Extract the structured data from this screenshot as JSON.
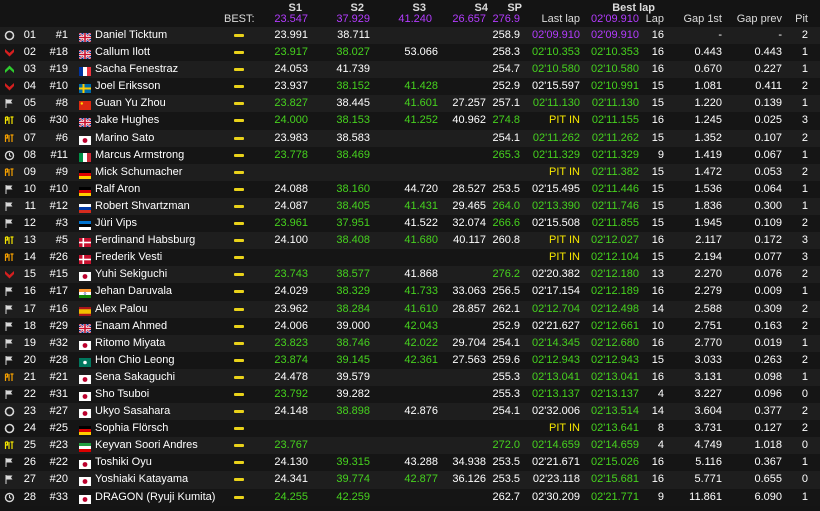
{
  "header": {
    "best_label": "BEST:",
    "columns": {
      "s1": "S1",
      "s2": "S2",
      "s3": "S3",
      "s4": "S4",
      "sp": "SP",
      "last_lap": "Last lap",
      "best_lap": "Best lap",
      "lap": "Lap",
      "gap_1st": "Gap 1st",
      "gap_prev": "Gap prev",
      "pit": "Pit"
    },
    "best": {
      "s1": "23.547",
      "s2": "37.929",
      "s3": "41.240",
      "s4": "26.657",
      "sp": "276.9",
      "best_lap": "02'09.910"
    }
  },
  "colors": {
    "white": "#ffffff",
    "green": "#46d21e",
    "purple": "#b43cff",
    "yellow": "#f5e600"
  },
  "rows": [
    {
      "status": "circle-icon",
      "pos": "01",
      "num": "#1",
      "flag": "gb",
      "name": "Daniel Ticktum",
      "s1": "23.991",
      "s1c": "w",
      "s2": "38.711",
      "s2c": "w",
      "s3": "",
      "s3c": "w",
      "s4": "",
      "s4c": "w",
      "sp": "258.9",
      "spc": "w",
      "last": "02'09.910",
      "lastc": "p",
      "best": "02'09.910",
      "bestc": "p",
      "lap": "16",
      "gap1": "-",
      "gapp": "-",
      "pit": "2"
    },
    {
      "status": "chevron-down-icon",
      "pos": "02",
      "num": "#18",
      "flag": "gb",
      "name": "Callum Ilott",
      "s1": "23.917",
      "s1c": "g",
      "s2": "38.027",
      "s2c": "g",
      "s3": "53.066",
      "s3c": "w",
      "s4": "",
      "s4c": "w",
      "sp": "258.3",
      "spc": "w",
      "last": "02'10.353",
      "lastc": "g",
      "best": "02'10.353",
      "bestc": "g",
      "lap": "16",
      "gap1": "0.443",
      "gapp": "0.443",
      "pit": "1"
    },
    {
      "status": "chevron-up-icon",
      "pos": "03",
      "num": "#19",
      "flag": "fr",
      "name": "Sacha Fenestraz",
      "s1": "24.053",
      "s1c": "w",
      "s2": "41.739",
      "s2c": "w",
      "s3": "",
      "s3c": "w",
      "s4": "",
      "s4c": "w",
      "sp": "254.7",
      "spc": "w",
      "last": "02'10.580",
      "lastc": "g",
      "best": "02'10.580",
      "bestc": "g",
      "lap": "16",
      "gap1": "0.670",
      "gapp": "0.227",
      "pit": "1"
    },
    {
      "status": "chevron-down-icon",
      "pos": "04",
      "num": "#10",
      "flag": "se",
      "name": "Joel Eriksson",
      "s1": "23.937",
      "s1c": "w",
      "s2": "38.152",
      "s2c": "g",
      "s3": "41.428",
      "s3c": "g",
      "s4": "",
      "s4c": "w",
      "sp": "252.9",
      "spc": "w",
      "last": "02'15.597",
      "lastc": "w",
      "best": "02'10.991",
      "bestc": "g",
      "lap": "15",
      "gap1": "1.081",
      "gapp": "0.411",
      "pit": "2"
    },
    {
      "status": "flag-icon",
      "pos": "05",
      "num": "#8",
      "flag": "cn",
      "name": "Guan Yu Zhou",
      "s1": "23.827",
      "s1c": "g",
      "s2": "38.445",
      "s2c": "w",
      "s3": "41.601",
      "s3c": "g",
      "s4": "27.257",
      "s4c": "w",
      "sp": "257.1",
      "spc": "w",
      "last": "02'11.130",
      "lastc": "g",
      "best": "02'11.130",
      "bestc": "g",
      "lap": "15",
      "gap1": "1.220",
      "gapp": "0.139",
      "pit": "1"
    },
    {
      "status": "pit-icon",
      "pos": "06",
      "num": "#30",
      "flag": "gb",
      "name": "Jake Hughes",
      "s1": "24.000",
      "s1c": "g",
      "s2": "38.153",
      "s2c": "g",
      "s3": "41.252",
      "s3c": "g",
      "s4": "40.962",
      "s4c": "w",
      "sp": "274.8",
      "spc": "g",
      "last": "PIT IN",
      "lastc": "y",
      "best": "02'11.155",
      "bestc": "g",
      "lap": "16",
      "gap1": "1.245",
      "gapp": "0.025",
      "pit": "3"
    },
    {
      "status": "pit-out-icon",
      "pos": "07",
      "num": "#6",
      "flag": "jp",
      "name": "Marino Sato",
      "s1": "23.983",
      "s1c": "w",
      "s2": "38.583",
      "s2c": "w",
      "s3": "",
      "s3c": "w",
      "s4": "",
      "s4c": "w",
      "sp": "254.1",
      "spc": "w",
      "last": "02'11.262",
      "lastc": "g",
      "best": "02'11.262",
      "bestc": "g",
      "lap": "15",
      "gap1": "1.352",
      "gapp": "0.107",
      "pit": "2"
    },
    {
      "status": "clock-icon",
      "pos": "08",
      "num": "#11",
      "flag": "it",
      "name": "Marcus Armstrong",
      "s1": "23.778",
      "s1c": "g",
      "s2": "38.469",
      "s2c": "g",
      "s3": "",
      "s3c": "w",
      "s4": "",
      "s4c": "w",
      "sp": "265.3",
      "spc": "g",
      "last": "02'11.329",
      "lastc": "g",
      "best": "02'11.329",
      "bestc": "g",
      "lap": "9",
      "gap1": "1.419",
      "gapp": "0.067",
      "pit": "1"
    },
    {
      "status": "pit-out-icon",
      "pos": "09",
      "num": "#9",
      "flag": "de",
      "name": "Mick Schumacher",
      "s1": "",
      "s1c": "w",
      "s2": "",
      "s2c": "w",
      "s3": "",
      "s3c": "w",
      "s4": "",
      "s4c": "w",
      "sp": "",
      "spc": "w",
      "last": "PIT IN",
      "lastc": "y",
      "best": "02'11.382",
      "bestc": "g",
      "lap": "15",
      "gap1": "1.472",
      "gapp": "0.053",
      "pit": "2"
    },
    {
      "status": "flag-icon",
      "pos": "10",
      "num": "#10",
      "flag": "de",
      "name": "Ralf Aron",
      "s1": "24.088",
      "s1c": "w",
      "s2": "38.160",
      "s2c": "g",
      "s3": "44.720",
      "s3c": "w",
      "s4": "28.527",
      "s4c": "w",
      "sp": "253.5",
      "spc": "w",
      "last": "02'15.495",
      "lastc": "w",
      "best": "02'11.446",
      "bestc": "g",
      "lap": "15",
      "gap1": "1.536",
      "gapp": "0.064",
      "pit": "1"
    },
    {
      "status": "flag-icon",
      "pos": "11",
      "num": "#12",
      "flag": "ru",
      "name": "Robert Shvartzman",
      "s1": "24.087",
      "s1c": "w",
      "s2": "38.405",
      "s2c": "g",
      "s3": "41.431",
      "s3c": "g",
      "s4": "29.465",
      "s4c": "w",
      "sp": "264.0",
      "spc": "g",
      "last": "02'13.390",
      "lastc": "g",
      "best": "02'11.746",
      "bestc": "g",
      "lap": "15",
      "gap1": "1.836",
      "gapp": "0.300",
      "pit": "1"
    },
    {
      "status": "flag-icon",
      "pos": "12",
      "num": "#3",
      "flag": "ee",
      "name": "Jüri Vips",
      "s1": "23.961",
      "s1c": "g",
      "s2": "37.951",
      "s2c": "g",
      "s3": "41.522",
      "s3c": "w",
      "s4": "32.074",
      "s4c": "w",
      "sp": "266.6",
      "spc": "g",
      "last": "02'15.508",
      "lastc": "w",
      "best": "02'11.855",
      "bestc": "g",
      "lap": "15",
      "gap1": "1.945",
      "gapp": "0.109",
      "pit": "2"
    },
    {
      "status": "pit-icon",
      "pos": "13",
      "num": "#5",
      "flag": "dk",
      "name": "Ferdinand Habsburg",
      "s1": "24.100",
      "s1c": "w",
      "s2": "38.408",
      "s2c": "g",
      "s3": "41.680",
      "s3c": "g",
      "s4": "40.117",
      "s4c": "w",
      "sp": "260.8",
      "spc": "w",
      "last": "PIT IN",
      "lastc": "y",
      "best": "02'12.027",
      "bestc": "g",
      "lap": "16",
      "gap1": "2.117",
      "gapp": "0.172",
      "pit": "3"
    },
    {
      "status": "pit-out-icon",
      "pos": "14",
      "num": "#26",
      "flag": "dk",
      "name": "Frederik Vesti",
      "s1": "",
      "s1c": "w",
      "s2": "",
      "s2c": "w",
      "s3": "",
      "s3c": "w",
      "s4": "",
      "s4c": "w",
      "sp": "",
      "spc": "w",
      "last": "PIT IN",
      "lastc": "y",
      "best": "02'12.104",
      "bestc": "g",
      "lap": "15",
      "gap1": "2.194",
      "gapp": "0.077",
      "pit": "3"
    },
    {
      "status": "chevron-down-icon",
      "pos": "15",
      "num": "#15",
      "flag": "jp",
      "name": "Yuhi Sekiguchi",
      "s1": "23.743",
      "s1c": "g",
      "s2": "38.577",
      "s2c": "g",
      "s3": "41.868",
      "s3c": "w",
      "s4": "",
      "s4c": "w",
      "sp": "276.2",
      "spc": "g",
      "last": "02'20.382",
      "lastc": "w",
      "best": "02'12.180",
      "bestc": "g",
      "lap": "13",
      "gap1": "2.270",
      "gapp": "0.076",
      "pit": "2"
    },
    {
      "status": "flag-icon",
      "pos": "16",
      "num": "#17",
      "flag": "in",
      "name": "Jehan Daruvala",
      "s1": "24.029",
      "s1c": "w",
      "s2": "38.329",
      "s2c": "g",
      "s3": "41.733",
      "s3c": "g",
      "s4": "33.063",
      "s4c": "w",
      "sp": "256.5",
      "spc": "w",
      "last": "02'17.154",
      "lastc": "w",
      "best": "02'12.189",
      "bestc": "g",
      "lap": "16",
      "gap1": "2.279",
      "gapp": "0.009",
      "pit": "1"
    },
    {
      "status": "flag-icon",
      "pos": "17",
      "num": "#16",
      "flag": "es",
      "name": "Alex Palou",
      "s1": "23.962",
      "s1c": "w",
      "s2": "38.284",
      "s2c": "g",
      "s3": "41.610",
      "s3c": "g",
      "s4": "28.857",
      "s4c": "w",
      "sp": "262.1",
      "spc": "w",
      "last": "02'12.704",
      "lastc": "g",
      "best": "02'12.498",
      "bestc": "g",
      "lap": "14",
      "gap1": "2.588",
      "gapp": "0.309",
      "pit": "2"
    },
    {
      "status": "flag-icon",
      "pos": "18",
      "num": "#29",
      "flag": "gb",
      "name": "Enaam Ahmed",
      "s1": "24.006",
      "s1c": "w",
      "s2": "39.000",
      "s2c": "w",
      "s3": "42.043",
      "s3c": "g",
      "s4": "",
      "s4c": "w",
      "sp": "252.9",
      "spc": "w",
      "last": "02'21.627",
      "lastc": "w",
      "best": "02'12.661",
      "bestc": "g",
      "lap": "10",
      "gap1": "2.751",
      "gapp": "0.163",
      "pit": "2"
    },
    {
      "status": "flag-icon",
      "pos": "19",
      "num": "#32",
      "flag": "jp",
      "name": "Ritomo Miyata",
      "s1": "23.823",
      "s1c": "g",
      "s2": "38.746",
      "s2c": "g",
      "s3": "42.022",
      "s3c": "g",
      "s4": "29.704",
      "s4c": "w",
      "sp": "254.1",
      "spc": "w",
      "last": "02'14.345",
      "lastc": "g",
      "best": "02'12.680",
      "bestc": "g",
      "lap": "16",
      "gap1": "2.770",
      "gapp": "0.019",
      "pit": "1"
    },
    {
      "status": "flag-icon",
      "pos": "20",
      "num": "#28",
      "flag": "mo",
      "name": "Hon Chio Leong",
      "s1": "23.874",
      "s1c": "g",
      "s2": "39.145",
      "s2c": "g",
      "s3": "42.361",
      "s3c": "g",
      "s4": "27.563",
      "s4c": "w",
      "sp": "259.6",
      "spc": "w",
      "last": "02'12.943",
      "lastc": "g",
      "best": "02'12.943",
      "bestc": "g",
      "lap": "15",
      "gap1": "3.033",
      "gapp": "0.263",
      "pit": "2"
    },
    {
      "status": "pit-out-icon",
      "pos": "21",
      "num": "#21",
      "flag": "jp",
      "name": "Sena Sakaguchi",
      "s1": "24.478",
      "s1c": "w",
      "s2": "39.579",
      "s2c": "w",
      "s3": "",
      "s3c": "w",
      "s4": "",
      "s4c": "w",
      "sp": "255.3",
      "spc": "w",
      "last": "02'13.041",
      "lastc": "g",
      "best": "02'13.041",
      "bestc": "g",
      "lap": "16",
      "gap1": "3.131",
      "gapp": "0.098",
      "pit": "1"
    },
    {
      "status": "flag-icon",
      "pos": "22",
      "num": "#31",
      "flag": "jp",
      "name": "Sho Tsuboi",
      "s1": "23.792",
      "s1c": "g",
      "s2": "39.282",
      "s2c": "w",
      "s3": "",
      "s3c": "w",
      "s4": "",
      "s4c": "w",
      "sp": "255.3",
      "spc": "w",
      "last": "02'13.137",
      "lastc": "g",
      "best": "02'13.137",
      "bestc": "g",
      "lap": "4",
      "gap1": "3.227",
      "gapp": "0.096",
      "pit": "0"
    },
    {
      "status": "circle-icon",
      "pos": "23",
      "num": "#27",
      "flag": "jp",
      "name": "Ukyo Sasahara",
      "s1": "24.148",
      "s1c": "w",
      "s2": "38.898",
      "s2c": "g",
      "s3": "42.876",
      "s3c": "w",
      "s4": "",
      "s4c": "w",
      "sp": "254.1",
      "spc": "w",
      "last": "02'32.006",
      "lastc": "w",
      "best": "02'13.514",
      "bestc": "g",
      "lap": "14",
      "gap1": "3.604",
      "gapp": "0.377",
      "pit": "2"
    },
    {
      "status": "circle-icon",
      "pos": "24",
      "num": "#25",
      "flag": "de",
      "name": "Sophia Flörsch",
      "s1": "",
      "s1c": "w",
      "s2": "",
      "s2c": "w",
      "s3": "",
      "s3c": "w",
      "s4": "",
      "s4c": "w",
      "sp": "",
      "spc": "w",
      "last": "PIT IN",
      "lastc": "y",
      "best": "02'13.641",
      "bestc": "g",
      "lap": "8",
      "gap1": "3.731",
      "gapp": "0.127",
      "pit": "2"
    },
    {
      "status": "pit-icon",
      "pos": "25",
      "num": "#23",
      "flag": "ir",
      "name": "Keyvan Soori Andres",
      "s1": "23.767",
      "s1c": "g",
      "s2": "",
      "s2c": "w",
      "s3": "",
      "s3c": "w",
      "s4": "",
      "s4c": "w",
      "sp": "272.0",
      "spc": "g",
      "last": "02'14.659",
      "lastc": "g",
      "best": "02'14.659",
      "bestc": "g",
      "lap": "4",
      "gap1": "4.749",
      "gapp": "1.018",
      "pit": "0"
    },
    {
      "status": "flag-icon",
      "pos": "26",
      "num": "#22",
      "flag": "jp",
      "name": "Toshiki Oyu",
      "s1": "24.130",
      "s1c": "w",
      "s2": "39.315",
      "s2c": "g",
      "s3": "43.288",
      "s3c": "w",
      "s4": "34.938",
      "s4c": "w",
      "sp": "253.5",
      "spc": "w",
      "last": "02'21.671",
      "lastc": "w",
      "best": "02'15.026",
      "bestc": "g",
      "lap": "16",
      "gap1": "5.116",
      "gapp": "0.367",
      "pit": "1"
    },
    {
      "status": "flag-icon",
      "pos": "27",
      "num": "#20",
      "flag": "jp",
      "name": "Yoshiaki Katayama",
      "s1": "24.341",
      "s1c": "w",
      "s2": "39.774",
      "s2c": "g",
      "s3": "42.877",
      "s3c": "g",
      "s4": "36.126",
      "s4c": "w",
      "sp": "253.5",
      "spc": "w",
      "last": "02'23.118",
      "lastc": "w",
      "best": "02'15.681",
      "bestc": "g",
      "lap": "16",
      "gap1": "5.771",
      "gapp": "0.655",
      "pit": "0"
    },
    {
      "status": "clock-icon",
      "pos": "28",
      "num": "#33",
      "flag": "jp",
      "name": "DRAGON (Ryuji Kumita)",
      "s1": "24.255",
      "s1c": "g",
      "s2": "42.259",
      "s2c": "g",
      "s3": "",
      "s3c": "w",
      "s4": "",
      "s4c": "w",
      "sp": "262.7",
      "spc": "w",
      "last": "02'30.209",
      "lastc": "w",
      "best": "02'21.771",
      "bestc": "g",
      "lap": "9",
      "gap1": "11.861",
      "gapp": "6.090",
      "pit": "1"
    }
  ]
}
